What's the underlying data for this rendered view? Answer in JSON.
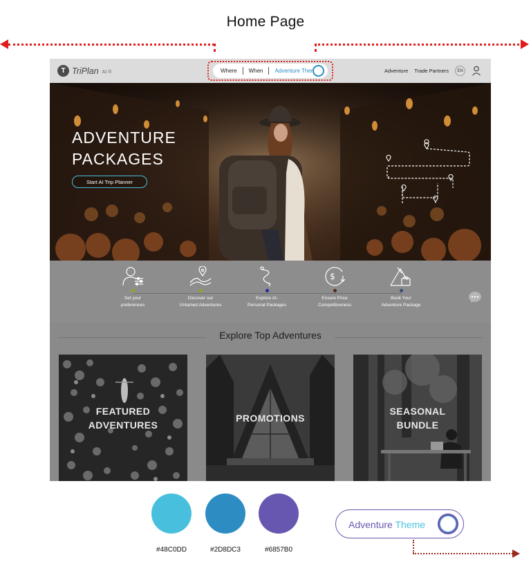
{
  "heading": "Home Page",
  "nav": {
    "brand": "TriPlan",
    "brand_suffix": "AI ®",
    "search": {
      "where": "Where",
      "when": "When",
      "theme": "Adventure Theme"
    },
    "links": [
      "Adventure",
      "Trade Partners"
    ],
    "lang": "EN"
  },
  "hero": {
    "title_line1": "ADVENTURE",
    "title_line2": "PACKAGES",
    "cta": "Start AI Trip Planner"
  },
  "steps": [
    {
      "line1": "Set your",
      "line2": "preferences",
      "dot": "#9aa51c",
      "icon": "person-sliders-icon"
    },
    {
      "line1": "Discover our",
      "line2": "Untamed Adventures",
      "dot": "#9aa51c",
      "icon": "map-pin-path-icon"
    },
    {
      "line1": "Explore AI-",
      "line2": "Personal Packages",
      "dot": "#2a2aa0",
      "icon": "route-icon"
    },
    {
      "line1": "Ensure Price",
      "line2": "Competitiveness",
      "dot": "#5a2a1a",
      "icon": "dollar-coin-icon"
    },
    {
      "line1": "Book Your",
      "line2": "Adventure Package",
      "dot": "#3a4a80",
      "icon": "tent-icon"
    }
  ],
  "explore": {
    "title": "Explore Top Adventures",
    "cards": [
      {
        "line1": "FEATURED",
        "line2": "ADVENTURES"
      },
      {
        "line1": "PROMOTIONS",
        "line2": ""
      },
      {
        "line1": "SEASONAL",
        "line2": "BUNDLE"
      }
    ]
  },
  "palette": [
    {
      "hex": "#48C0DD",
      "label": "#48C0DD"
    },
    {
      "hex": "#2D8DC3",
      "label": "#2D8DC3"
    },
    {
      "hex": "#6857B0",
      "label": "#6857B0"
    }
  ],
  "theme_toggle": {
    "word1": "Adventure",
    "word2": "Theme"
  },
  "colors": {
    "annotation_red": "#e01c1c",
    "accent_cyan": "#48C0DD",
    "accent_blue": "#2D8DC3",
    "accent_purple": "#6857B0"
  }
}
